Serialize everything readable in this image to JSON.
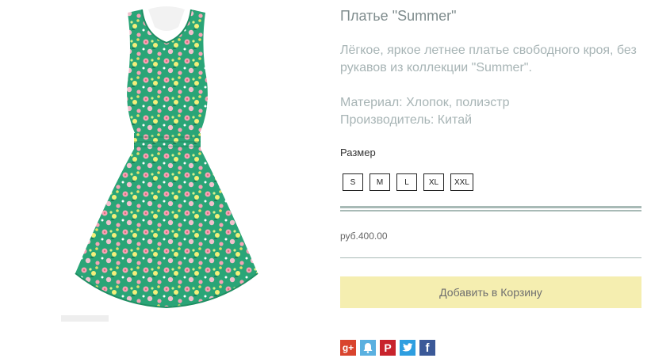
{
  "product": {
    "title": "Платье \"Summer\"",
    "description": "Лёгкое, яркое летнее платье свободного кроя, без рукавов из коллекции \"Summer\".",
    "material": "Материал: Хлопок, полиэстр",
    "manufacturer": "Производитель: Китай",
    "size_label": "Размер",
    "sizes": [
      "S",
      "M",
      "L",
      "XL",
      "XXL"
    ],
    "price": "руб.400.00",
    "add_to_cart_label": "Добавить в Корзину"
  },
  "share": [
    {
      "icon": "google-plus-icon",
      "glyph": "g+",
      "color": "#d9442e"
    },
    {
      "icon": "alert-bell-icon",
      "glyph": "",
      "color": "#5ab0e0"
    },
    {
      "icon": "pinterest-icon",
      "glyph": "P",
      "color": "#c8232c"
    },
    {
      "icon": "twitter-icon",
      "glyph": "",
      "color": "#2e9ee0"
    },
    {
      "icon": "facebook-icon",
      "glyph": "f",
      "color": "#3b5998"
    }
  ],
  "colors": {
    "dress_green": "#2aa577",
    "button_bg": "#f5eeb0",
    "rule": "#a8bab6"
  }
}
